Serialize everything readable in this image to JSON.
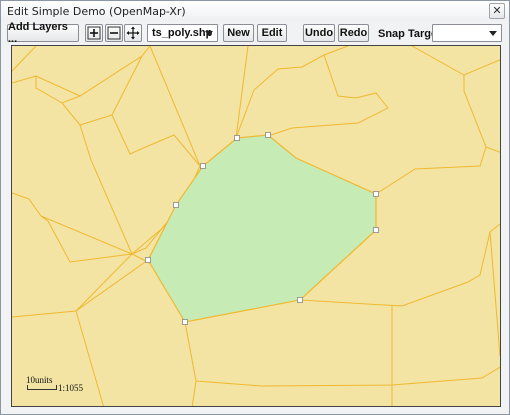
{
  "window": {
    "title": "Edit Simple Demo (OpenMap-Xr)",
    "close_glyph": "✕"
  },
  "toolbar": {
    "add_layers_label": "Add Layers ...",
    "zoom_in_icon": "zoom-in-icon",
    "zoom_out_icon": "zoom-out-icon",
    "pan_icon": "pan-icon",
    "layer_select": {
      "value": "ts_poly.shp"
    },
    "new_label": "New",
    "edit_label": "Edit",
    "undo_label": "Undo",
    "redo_label": "Redo",
    "snap_target_label": "Snap Target",
    "snap_target_select": {
      "value": ""
    }
  },
  "map": {
    "colors": {
      "background": "#f3e4a4",
      "polygon_edges": "#f0b830",
      "selected_fill": "#c6ebb4",
      "vertex_handle": "#ffffff"
    },
    "scale": {
      "units_label": "10units",
      "ratio_label": "1:1055"
    }
  }
}
